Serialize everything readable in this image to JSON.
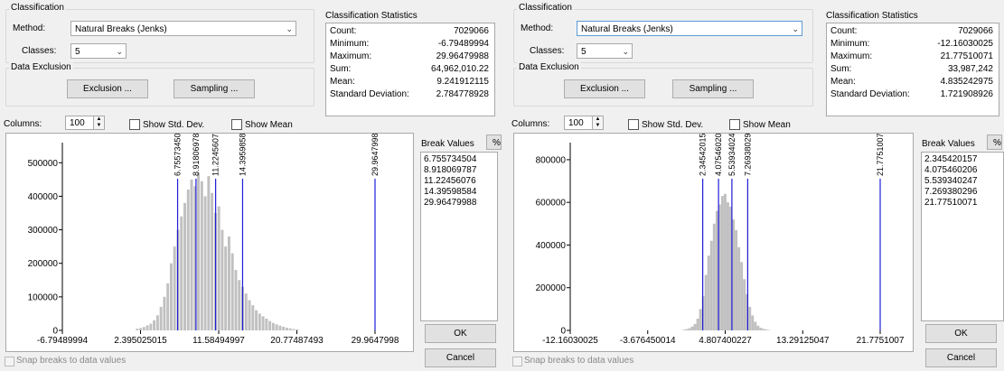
{
  "common": {
    "classification_title": "Classification",
    "method_label": "Method:",
    "classes_label": "Classes:",
    "data_exclusion_title": "Data Exclusion",
    "exclusion_button": "Exclusion ...",
    "sampling_button": "Sampling ...",
    "stats_title": "Classification Statistics",
    "columns_label": "Columns:",
    "show_std_dev": "Show Std. Dev.",
    "show_mean": "Show Mean",
    "break_values_label": "Break Values",
    "percent_button": "%",
    "ok_button": "OK",
    "cancel_button": "Cancel",
    "snap_label": "Snap breaks to data values",
    "colors": {
      "bar": "#c0c0c0",
      "break_line": "#1e1ed7",
      "window": "#f0f0f0"
    }
  },
  "dialogs": [
    {
      "method": "Natural Breaks (Jenks)",
      "classes": "5",
      "columns": "100",
      "stats": [
        {
          "k": "Count:",
          "v": "7029066"
        },
        {
          "k": "Minimum:",
          "v": "-6.79489994"
        },
        {
          "k": "Maximum:",
          "v": "29.96479988"
        },
        {
          "k": "Sum:",
          "v": "64,962,010.22"
        },
        {
          "k": "Mean:",
          "v": "9.241912115"
        },
        {
          "k": "Standard Deviation:",
          "v": "2.784778928"
        }
      ],
      "break_values": [
        "6.755734504",
        "8.918069787",
        "11.22456076",
        "14.39598584",
        "29.96479988"
      ],
      "chart_data": {
        "type": "bar",
        "xlim": [
          -6.79489994,
          29.96479988
        ],
        "ylim": [
          0,
          560000
        ],
        "yticks": [
          0,
          100000,
          200000,
          300000,
          400000,
          500000
        ],
        "xticks": [
          "-6.79489994",
          "2.395025015",
          "11.58494997",
          "20.77487493",
          "29.9647998"
        ],
        "breaks": [
          6.755734504,
          8.918069787,
          11.22456076,
          14.39598584,
          29.96479988
        ],
        "break_labels": [
          "6.755734504",
          "8.918069787",
          "11.22456076",
          "14.39598584",
          "29.96479988"
        ],
        "bin_centers": [
          2.0,
          2.4,
          2.8,
          3.2,
          3.6,
          4.0,
          4.4,
          4.8,
          5.2,
          5.6,
          6.0,
          6.4,
          6.8,
          7.2,
          7.6,
          8.0,
          8.4,
          8.8,
          9.2,
          9.6,
          10.0,
          10.4,
          10.8,
          11.2,
          11.6,
          12.0,
          12.4,
          12.8,
          13.2,
          13.6,
          14.0,
          14.4,
          14.8,
          15.2,
          15.6,
          16.0,
          16.4,
          16.8,
          17.2,
          17.6,
          18.0,
          18.4,
          18.8,
          19.2,
          19.6,
          20.0,
          20.4,
          20.8
        ],
        "values": [
          5000,
          7000,
          10000,
          15000,
          20000,
          30000,
          45000,
          70000,
          100000,
          140000,
          200000,
          250000,
          300000,
          340000,
          380000,
          420000,
          450000,
          430000,
          470000,
          445000,
          400000,
          460000,
          410000,
          350000,
          370000,
          300000,
          250000,
          280000,
          230000,
          180000,
          150000,
          130000,
          110000,
          90000,
          75000,
          60000,
          50000,
          42000,
          35000,
          28000,
          22000,
          18000,
          14000,
          11000,
          8000,
          6000,
          4000,
          3000
        ]
      }
    },
    {
      "method": "Natural Breaks (Jenks)",
      "classes": "5",
      "columns": "100",
      "stats": [
        {
          "k": "Count:",
          "v": "7029066"
        },
        {
          "k": "Minimum:",
          "v": "-12.16030025"
        },
        {
          "k": "Maximum:",
          "v": "21.77510071"
        },
        {
          "k": "Sum:",
          "v": "33,987,242"
        },
        {
          "k": "Mean:",
          "v": "4.835242975"
        },
        {
          "k": "Standard Deviation:",
          "v": "1.721908926"
        }
      ],
      "break_values": [
        "2.345420157",
        "4.075460206",
        "5.539340247",
        "7.269380296",
        "21.77510071"
      ],
      "chart_data": {
        "type": "bar",
        "xlim": [
          -12.16030025,
          21.77510071
        ],
        "ylim": [
          0,
          880000
        ],
        "yticks": [
          0,
          200000,
          400000,
          600000,
          800000
        ],
        "xticks": [
          "-12.16030025",
          "-3.676450014",
          "4.807400227",
          "13.29125047",
          "21.7751007"
        ],
        "breaks": [
          2.345420157,
          4.075460206,
          5.539340247,
          7.269380296,
          21.77510071
        ],
        "break_labels": [
          "2.345420157",
          "4.075460206",
          "5.539340247",
          "7.269380296",
          "21.77510071"
        ],
        "bin_centers": [
          0.3,
          0.6,
          0.9,
          1.2,
          1.5,
          1.8,
          2.1,
          2.4,
          2.7,
          3.0,
          3.3,
          3.6,
          3.9,
          4.2,
          4.5,
          4.8,
          5.1,
          5.4,
          5.7,
          6.0,
          6.3,
          6.6,
          6.9,
          7.2,
          7.5,
          7.8,
          8.1,
          8.4,
          8.7,
          9.0,
          9.3,
          9.6
        ],
        "values": [
          3000,
          6000,
          10000,
          18000,
          30000,
          55000,
          100000,
          160000,
          260000,
          350000,
          420000,
          500000,
          560000,
          590000,
          630000,
          640000,
          600000,
          580000,
          520000,
          470000,
          390000,
          320000,
          240000,
          170000,
          110000,
          70000,
          40000,
          22000,
          12000,
          7000,
          4000,
          2000
        ]
      }
    }
  ]
}
